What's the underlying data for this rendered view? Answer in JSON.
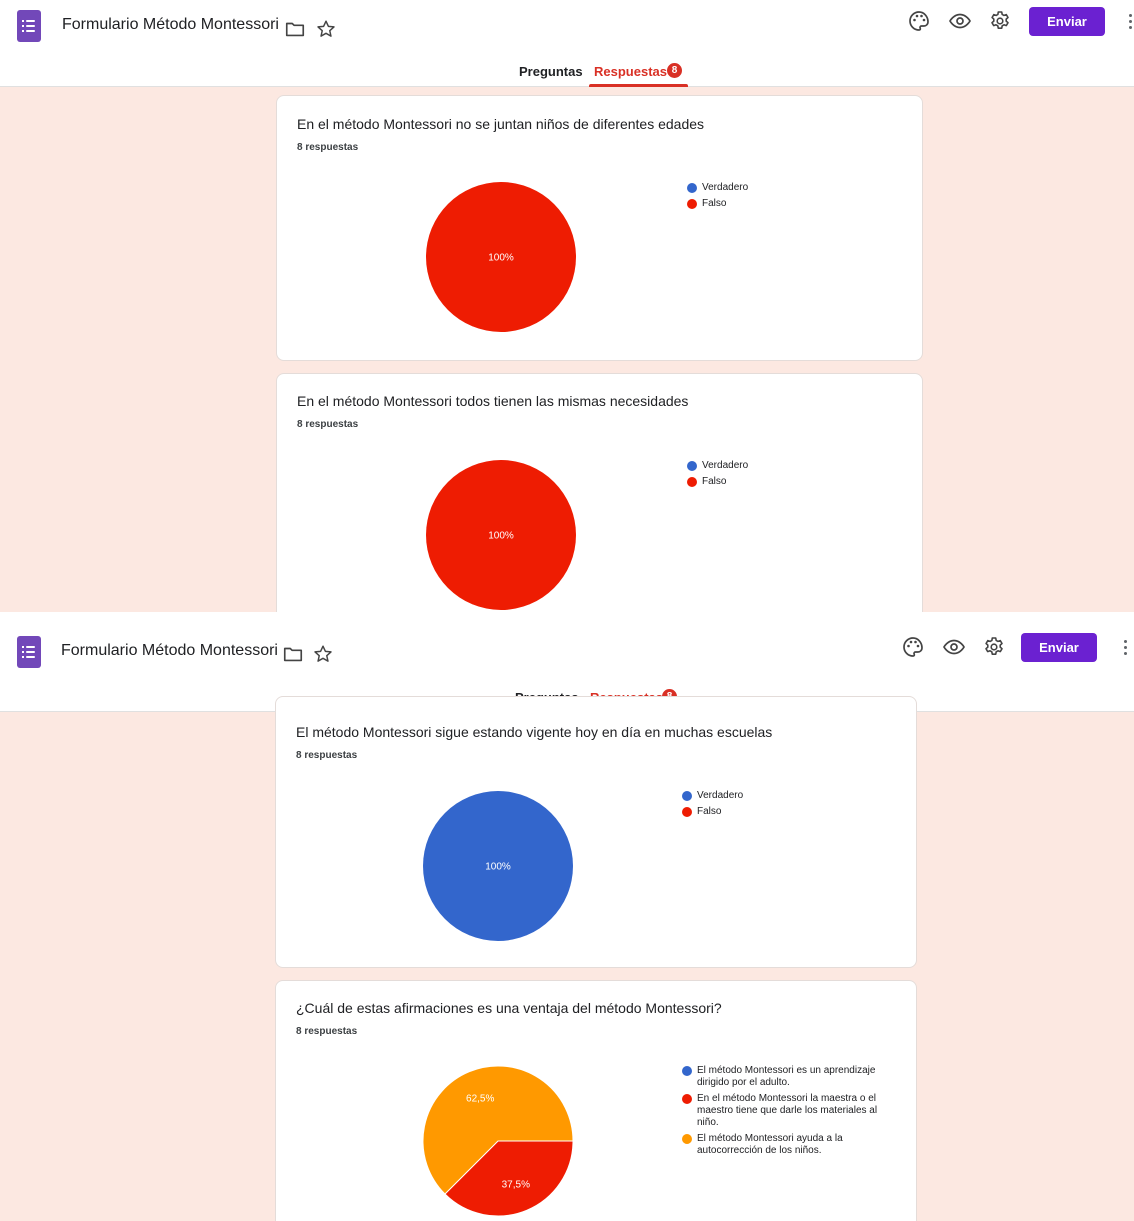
{
  "app": {
    "form_title": "Formulario Método Montessori",
    "send_label": "Enviar"
  },
  "tabs": {
    "questions_label": "Preguntas",
    "responses_label": "Respuestas",
    "responses_count": "8"
  },
  "icons": {
    "logo": "google-forms-icon",
    "folder": "folder-icon",
    "star": "star-icon",
    "palette": "palette-icon",
    "preview": "eye-icon",
    "settings": "gear-icon",
    "more": "more-vert-icon"
  },
  "colors": {
    "accent": "#6b21d1",
    "responses_red": "#d93025",
    "background": "#fce8e1",
    "blue": "#3366cc",
    "red": "#ee1c02",
    "orange": "#ff9900"
  },
  "cards": [
    {
      "title": "En el método Montessori no se juntan niños de diferentes edades",
      "count": "8 respuestas",
      "legend": [
        {
          "label": "Verdadero",
          "color": "#3366cc"
        },
        {
          "label": "Falso",
          "color": "#ee1c02"
        }
      ],
      "slices": [
        {
          "value": 100,
          "label": "100%",
          "color": "#ee1c02"
        }
      ]
    },
    {
      "title": "En el método Montessori todos tienen las mismas necesidades",
      "count": "8 respuestas",
      "legend": [
        {
          "label": "Verdadero",
          "color": "#3366cc"
        },
        {
          "label": "Falso",
          "color": "#ee1c02"
        }
      ],
      "slices": [
        {
          "value": 100,
          "label": "100%",
          "color": "#ee1c02"
        }
      ]
    },
    {
      "title": "El método Montessori sigue estando vigente hoy en día en muchas escuelas",
      "count": "8 respuestas",
      "legend": [
        {
          "label": "Verdadero",
          "color": "#3366cc"
        },
        {
          "label": "Falso",
          "color": "#ee1c02"
        }
      ],
      "slices": [
        {
          "value": 100,
          "label": "100%",
          "color": "#3366cc"
        }
      ]
    },
    {
      "title": "¿Cuál de estas afirmaciones es una ventaja del método Montessori?",
      "count": "8 respuestas",
      "legend": [
        {
          "label": "El método Montessori es un aprendizaje dirigido por el adulto.",
          "color": "#3366cc"
        },
        {
          "label": "En el método Montessori la maestra o el maestro tiene que darle los materiales al niño.",
          "color": "#ee1c02"
        },
        {
          "label": "El método Montessori ayuda a la autocorrección de los niños.",
          "color": "#ff9900"
        }
      ],
      "slices": [
        {
          "value": 37.5,
          "label": "37,5%",
          "color": "#ee1c02"
        },
        {
          "value": 62.5,
          "label": "62,5%",
          "color": "#ff9900"
        }
      ]
    }
  ],
  "chart_data": [
    {
      "type": "pie",
      "title": "En el método Montessori no se juntan niños de diferentes edades",
      "categories": [
        "Verdadero",
        "Falso"
      ],
      "values": [
        0,
        100
      ],
      "labels": [
        "",
        "100%"
      ]
    },
    {
      "type": "pie",
      "title": "En el método Montessori todos tienen las mismas necesidades",
      "categories": [
        "Verdadero",
        "Falso"
      ],
      "values": [
        0,
        100
      ],
      "labels": [
        "",
        "100%"
      ]
    },
    {
      "type": "pie",
      "title": "El método Montessori sigue estando vigente hoy en día en muchas escuelas",
      "categories": [
        "Verdadero",
        "Falso"
      ],
      "values": [
        100,
        0
      ],
      "labels": [
        "100%",
        ""
      ]
    },
    {
      "type": "pie",
      "title": "¿Cuál de estas afirmaciones es una ventaja del método Montessori?",
      "categories": [
        "El método Montessori es un aprendizaje dirigido por el adulto.",
        "En el método Montessori la maestra o el maestro tiene que darle los materiales al niño.",
        "El método Montessori ayuda a la autocorrección de los niños."
      ],
      "values": [
        0,
        37.5,
        62.5
      ],
      "labels": [
        "",
        "37,5%",
        "62,5%"
      ]
    }
  ]
}
